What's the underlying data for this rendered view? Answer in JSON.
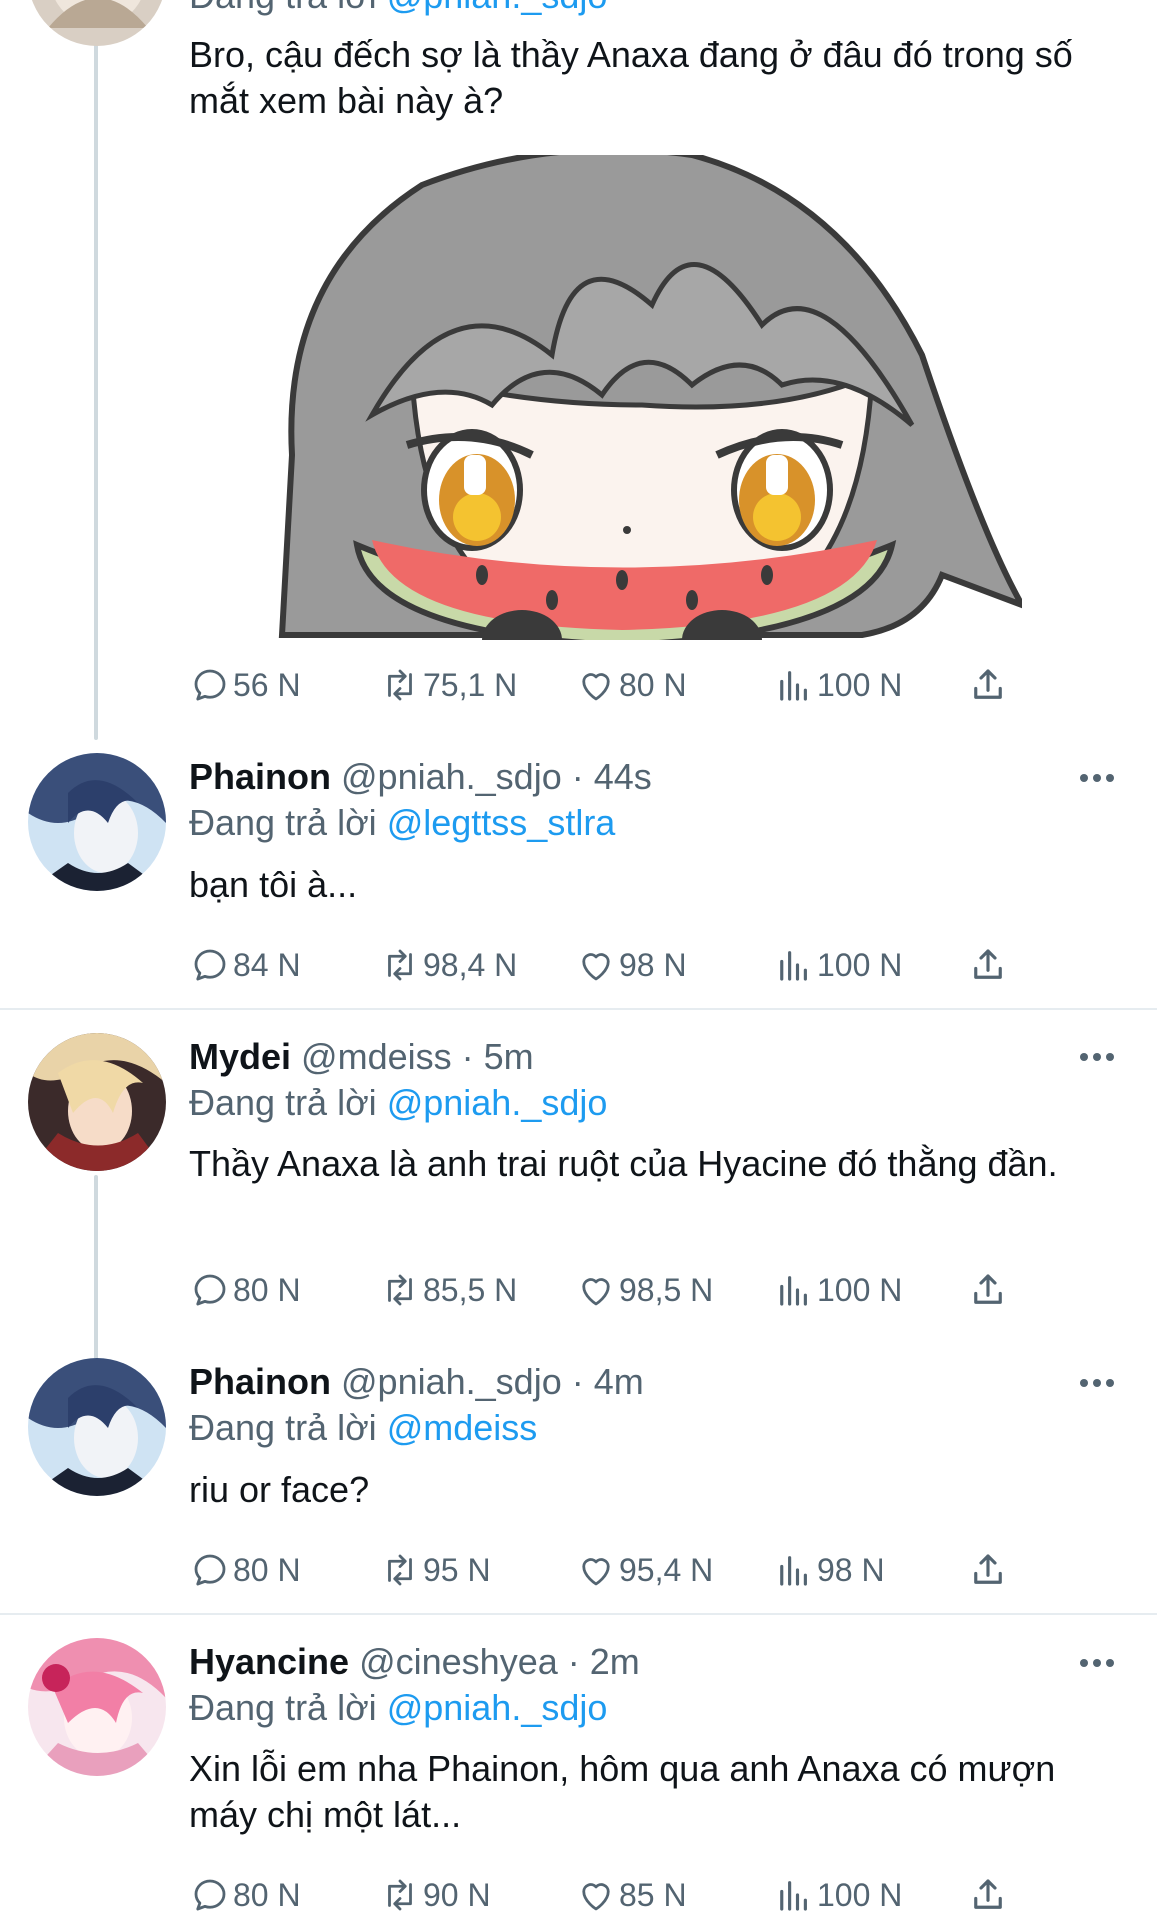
{
  "top_tweet": {
    "replying_prefix": "Đang trả lời",
    "mention": "@pniah._sdjo",
    "text": "Bro, cậu đếch sợ là thầy Anaxa đang ở đâu đó trong số mắt xem bài này à?",
    "stats": {
      "replies": "56 N",
      "retweets": "75,1 N",
      "likes": "80 N",
      "views": "100 N"
    }
  },
  "tweets": [
    {
      "name": "Phainon",
      "handle": "@pniah._sdjo",
      "dot": "·",
      "time": "44s",
      "replying_prefix": "Đang trả lời",
      "mention": "@legttss_stlra",
      "text": "bạn tôi à...",
      "stats": {
        "replies": "84 N",
        "retweets": "98,4 N",
        "likes": "98 N",
        "views": "100 N"
      }
    },
    {
      "name": "Mydei",
      "handle": "@mdeiss",
      "dot": "·",
      "time": "5m",
      "replying_prefix": "Đang trả lời",
      "mention": "@pniah._sdjo",
      "text": "Thầy Anaxa là anh trai ruột của Hyacine đó thằng đần.",
      "stats": {
        "replies": "80 N",
        "retweets": "85,5 N",
        "likes": "98,5 N",
        "views": "100 N"
      }
    },
    {
      "name": "Phainon",
      "handle": "@pniah._sdjo",
      "dot": "·",
      "time": "4m",
      "replying_prefix": "Đang trả lời",
      "mention": "@mdeiss",
      "text": "riu or face?",
      "stats": {
        "replies": "80 N",
        "retweets": "95 N",
        "likes": "95,4 N",
        "views": "98 N"
      }
    },
    {
      "name": "Hyancine",
      "handle": "@cineshyea",
      "dot": "·",
      "time": "2m",
      "replying_prefix": "Đang trả lời",
      "mention": "@pniah._sdjo",
      "text": "Xin lỗi em nha Phainon, hôm qua anh Anaxa có mượn máy chị một lát...",
      "stats": {
        "replies": "80 N",
        "retweets": "90 N",
        "likes": "85 N",
        "views": "100 N"
      }
    }
  ],
  "icons": [
    "reply-icon",
    "retweet-icon",
    "like-icon",
    "views-icon",
    "share-icon",
    "more-icon"
  ],
  "colors": {
    "mention": "#1d9bf0",
    "muted": "#536471",
    "text": "#0f1419",
    "thread_line": "#cfd9de"
  }
}
